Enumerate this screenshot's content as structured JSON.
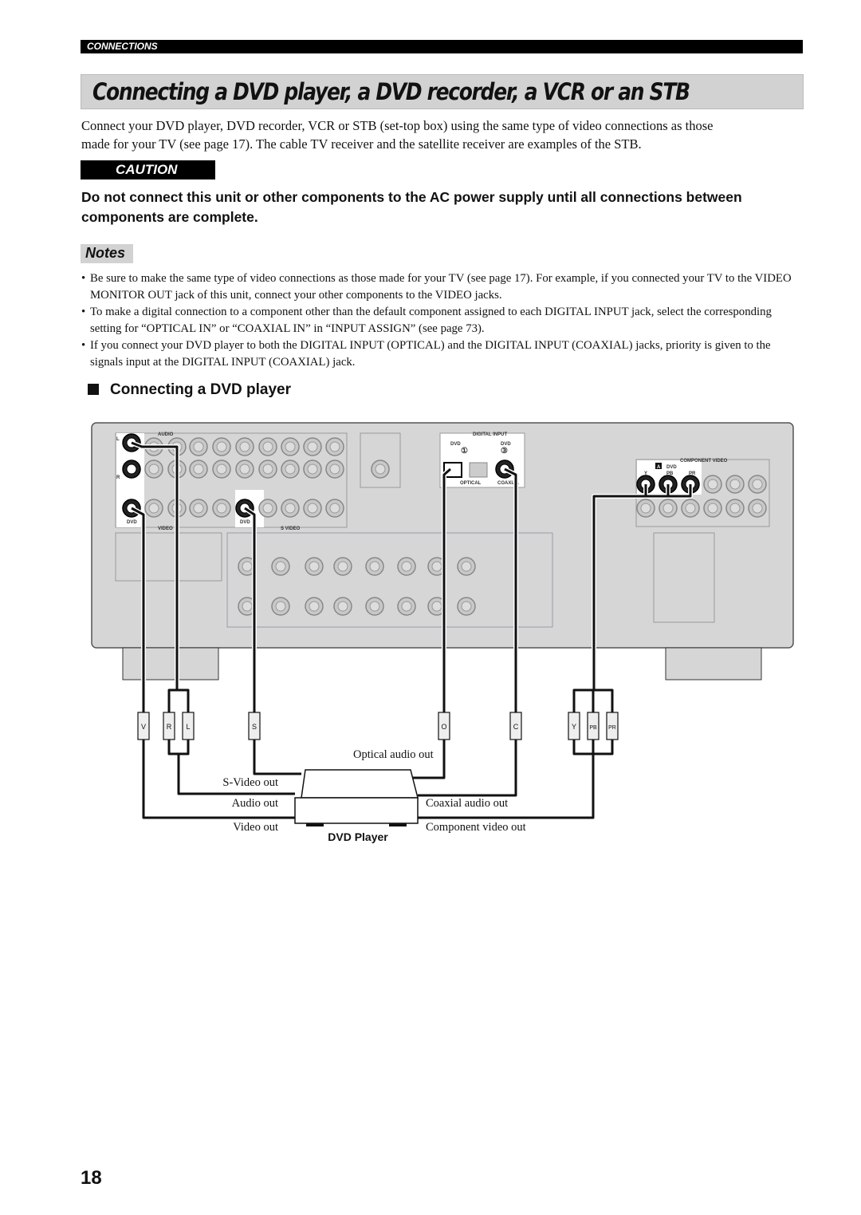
{
  "header": {
    "section": "CONNECTIONS"
  },
  "title": "Connecting a DVD player, a DVD recorder, a VCR or an STB",
  "intro": [
    "Connect your DVD player, DVD recorder, VCR or STB (set-top box) using the same type of video connections as those",
    "made for your TV (see page 17). The cable TV receiver and the satellite receiver are examples of the STB."
  ],
  "caution": {
    "label": "CAUTION",
    "text": "Do not connect this unit or other components to the AC power supply until all connections between components are complete."
  },
  "notes": {
    "label": "Notes",
    "items": [
      "Be sure to make the same type of video connections as those made for your TV (see page 17). For example, if you connected your TV to the VIDEO MONITOR OUT jack of this unit, connect your other components to the VIDEO jacks.",
      "To make a digital connection to a component other than the default component assigned to each DIGITAL INPUT jack, select the corresponding setting for “OPTICAL IN” or “COAXIAL IN” in “INPUT ASSIGN” (see page 73).",
      "If you connect your DVD player to both the DIGITAL INPUT (OPTICAL) and the DIGITAL INPUT (COAXIAL) jacks, priority is given to the signals input at the DIGITAL INPUT (COAXIAL) jack."
    ]
  },
  "section_heading": "Connecting a DVD player",
  "diagram": {
    "panel": {
      "audio": "AUDIO",
      "l": "L",
      "r": "R",
      "dvd_video": "DVD",
      "video": "VIDEO",
      "dvd_svideo": "DVD",
      "svideo": "S VIDEO",
      "digital_input": "DIGITAL INPUT",
      "dvd1": "DVD",
      "num1": "①",
      "dvd3": "DVD",
      "num3": "③",
      "optical": "OPTICAL",
      "coaxial": "COAXIAL",
      "component_video": "COMPONENT VIDEO",
      "a": "A",
      "dvd_comp": "DVD",
      "y": "Y",
      "pb": "PB",
      "pr": "PR"
    },
    "plugs": [
      "V",
      "R",
      "L",
      "S",
      "O",
      "C",
      "Y",
      "PB",
      "PR"
    ],
    "outputs": {
      "optical": "Optical audio out",
      "svideo": "S-Video out",
      "audio": "Audio out",
      "coaxial": "Coaxial audio out",
      "video": "Video out",
      "component": "Component video out"
    },
    "device": "DVD Player"
  },
  "page_number": "18"
}
